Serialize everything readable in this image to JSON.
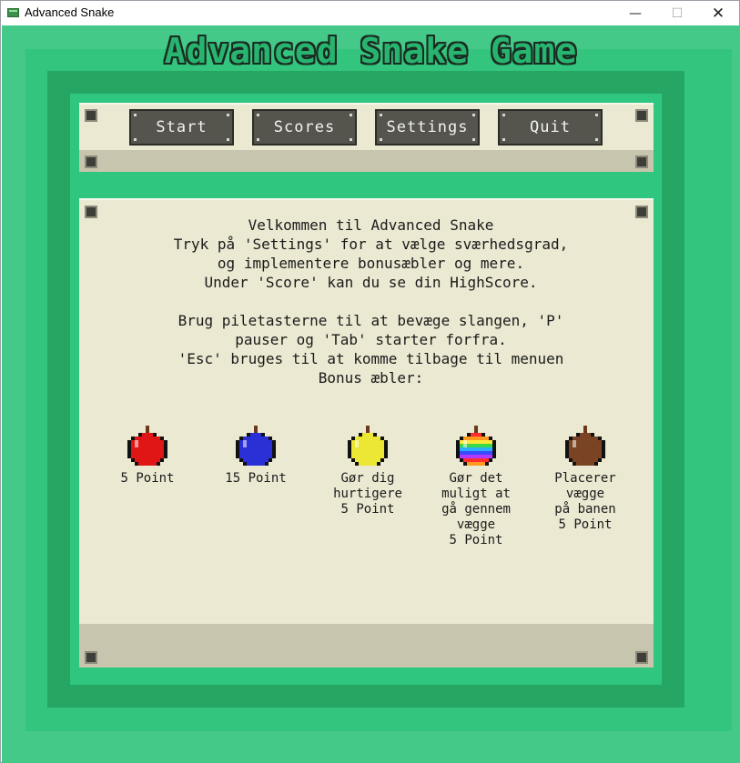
{
  "window": {
    "title": "Advanced Snake"
  },
  "game": {
    "title": "Advanced Snake Game"
  },
  "menu": {
    "start": "Start",
    "scores": "Scores",
    "settings": "Settings",
    "quit": "Quit"
  },
  "info": {
    "lines": [
      "Velkommen til Advanced Snake",
      "Tryk på 'Settings' for at vælge sværhedsgrad,",
      "og implementere bonusæbler og mere.",
      "Under 'Score' kan du se din HighScore.",
      "",
      "Brug piletasterne til at bevæge slangen, 'P'",
      "pauser og 'Tab' starter forfra.",
      "'Esc' bruges til at komme tilbage til menuen",
      "Bonus æbler:"
    ]
  },
  "apples": [
    {
      "name": "red-apple-icon",
      "color": "#e01515",
      "label": "5 Point"
    },
    {
      "name": "blue-apple-icon",
      "color": "#2a2fd6",
      "label": "15 Point"
    },
    {
      "name": "yellow-apple-icon",
      "color": "#ece634",
      "label": "Gør dig\nhurtigere\n5 Point"
    },
    {
      "name": "rainbow-apple-icon",
      "color": "rainbow",
      "label": "Gør det\nmuligt at\ngå gennem\nvægge\n5 Point"
    },
    {
      "name": "brown-apple-icon",
      "color": "#7a4424",
      "label": "Placerer\nvægge\npå banen\n5 Point"
    }
  ],
  "colors": {
    "background": "#44c989",
    "panel": "#ebe9d2",
    "panel_footer": "#c7c5ad",
    "button": "#55554e"
  }
}
